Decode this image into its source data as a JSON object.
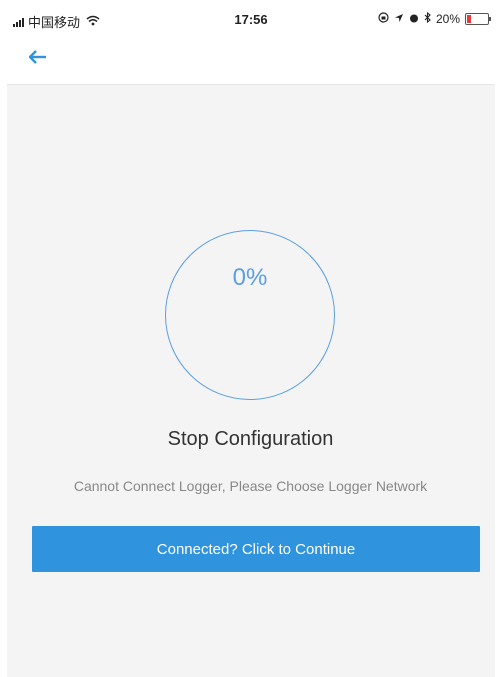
{
  "status_bar": {
    "carrier": "中国移动",
    "time": "17:56",
    "battery_percent": "20%",
    "battery_level": 0.2,
    "battery_color": "#e83a3a"
  },
  "nav": {
    "back_icon": "back-arrow-icon"
  },
  "progress": {
    "text": "0%",
    "value": 0,
    "color": "#5b9fe3"
  },
  "title": "Stop Configuration",
  "message": "Cannot Connect Logger, Please Choose Logger Network",
  "continue_button": {
    "label": "Connected? Click to Continue",
    "color": "#2f93dd"
  }
}
